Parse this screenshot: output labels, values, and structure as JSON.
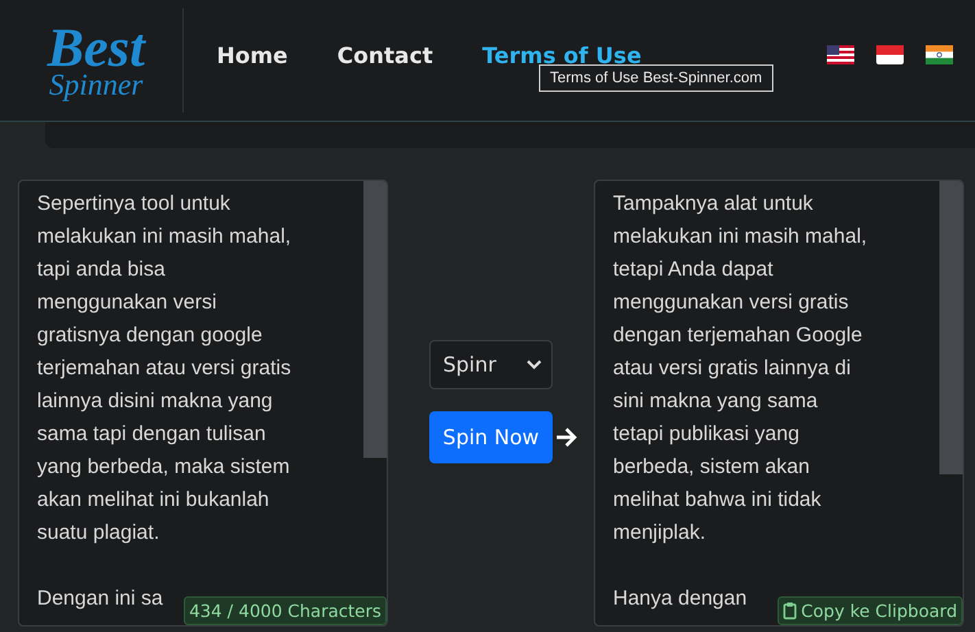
{
  "header": {
    "logo_top": "Best",
    "logo_bottom": "Spinner",
    "nav": [
      {
        "label": "Home",
        "selected": false
      },
      {
        "label": "Contact",
        "selected": false
      },
      {
        "label": "Terms of Use",
        "selected": true
      }
    ],
    "tooltip": "Terms of Use Best-Spinner.com"
  },
  "input": {
    "paragraphs": [
      [
        "Sepertinya tool untuk",
        "melakukan ini masih mahal,",
        "tapi anda bisa",
        "menggunakan versi",
        "gratisnya dengan google",
        "terjemahan atau versi gratis",
        "lainnya disini makna yang",
        "sama tapi dengan tulisan",
        "yang berbeda, maka sistem",
        "akan melihat ini bukanlah",
        "suatu plagiat."
      ],
      [
        "Dengan ini sa"
      ]
    ],
    "counter": "434 / 4000 Characters"
  },
  "controls": {
    "select_value": "Spinr",
    "button": "Spin Now"
  },
  "output": {
    "paragraphs": [
      [
        "Tampaknya alat untuk",
        "melakukan ini masih mahal,",
        "tetapi Anda dapat",
        "menggunakan versi gratis",
        "dengan terjemahan Google",
        "atau versi gratis lainnya di",
        "sini makna yang sama",
        "tetapi publikasi yang",
        "berbeda, sistem akan",
        "melihat bahwa ini tidak",
        "menjiplak."
      ],
      [
        "Hanya dengan"
      ]
    ],
    "copy_button": "Copy ke Clipboard"
  }
}
